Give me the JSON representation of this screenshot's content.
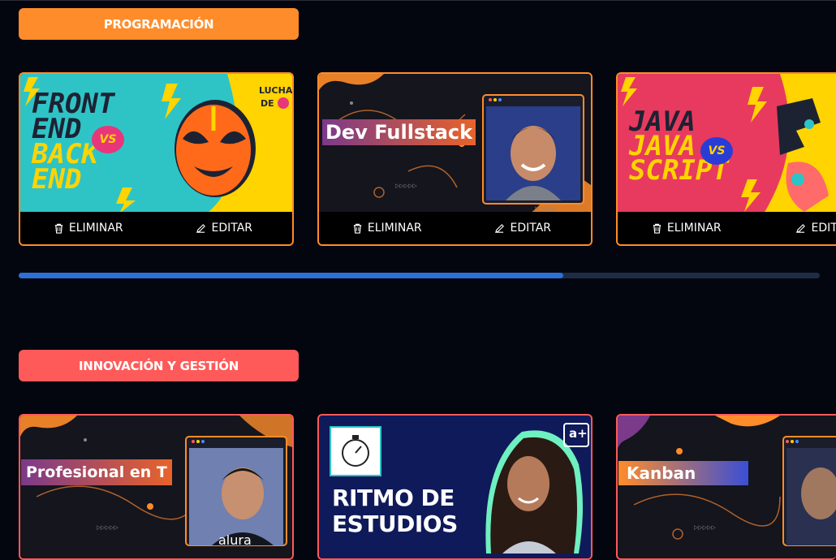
{
  "categories": [
    {
      "label": "PROGRAMACIÓN",
      "color": "#ff8c2a",
      "cards": [
        {
          "thumb_title": [
            "FRONT",
            "END",
            "BACK",
            "END"
          ],
          "vs": "VS",
          "badge": [
            "LUCHA",
            "DE"
          ]
        },
        {
          "thumb_title": "Dev Fullstack"
        },
        {
          "thumb_title": [
            "JAVA",
            "JAVA",
            "SCRIPT"
          ],
          "vs": "VS"
        }
      ],
      "scroll_progress": 0.68
    },
    {
      "label": "INNOVACIÓN Y GESTIÓN",
      "color": "#ff5a5a",
      "cards": [
        {
          "thumb_title": "Profesional en T",
          "shirt_text": "alura"
        },
        {
          "thumb_title": [
            "RITMO DE",
            "ESTUDIOS"
          ],
          "logo": "a+"
        },
        {
          "thumb_title": "Kanban"
        }
      ]
    }
  ],
  "actions": {
    "delete_label": "ELIMINAR",
    "edit_label": "EDITAR"
  },
  "colors": {
    "accent_orange": "#ff8c2a",
    "accent_red": "#ff5a5a",
    "scroll_track": "#1e2c46",
    "scroll_thumb": "#2c6fd6"
  },
  "icons": {
    "delete": "trash-icon",
    "edit": "pencil-icon"
  }
}
